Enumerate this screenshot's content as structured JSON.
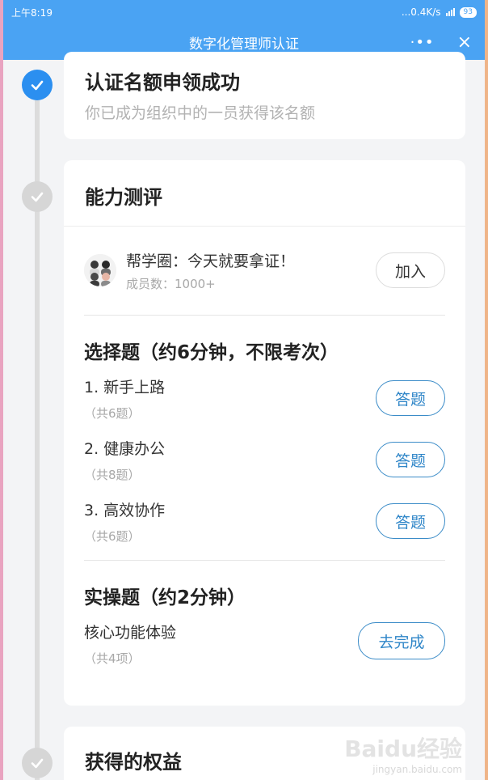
{
  "status_bar": {
    "time": "上午8:19",
    "network": "...0.4K/s",
    "battery": "93"
  },
  "header": {
    "title": "数字化管理师认证",
    "more": "·••",
    "close": "×"
  },
  "steps": [
    {
      "state": "done",
      "title": "认证名额申领成功",
      "subtitle": "你已成为组织中的一员获得该名额"
    },
    {
      "state": "pending",
      "title": "能力测评"
    },
    {
      "state": "pending",
      "title": "获得的权益"
    }
  ],
  "group": {
    "name": "帮学圈：今天就要拿证！",
    "members": "成员数：1000+",
    "join_label": "加入"
  },
  "choice_section": {
    "title": "选择题（约6分钟，不限考次）",
    "items": [
      {
        "name": "1. 新手上路",
        "count": "（共6题）",
        "action": "答题"
      },
      {
        "name": "2. 健康办公",
        "count": "（共8题）",
        "action": "答题"
      },
      {
        "name": "3. 高效协作",
        "count": "（共6题）",
        "action": "答题"
      }
    ]
  },
  "practice_section": {
    "title": "实操题（约2分钟）",
    "item": {
      "name": "核心功能体验",
      "count": "（共4项）",
      "action": "去完成"
    }
  },
  "watermark": {
    "brand": "Baidu经验",
    "url": "jingyan.baidu.com"
  },
  "colors": {
    "accent": "#4aa3f3",
    "done": "#2b8ff0",
    "button_border": "#3b8cc8"
  },
  "icons": {
    "done_step": "check-icon",
    "pending_step": "check-icon"
  }
}
